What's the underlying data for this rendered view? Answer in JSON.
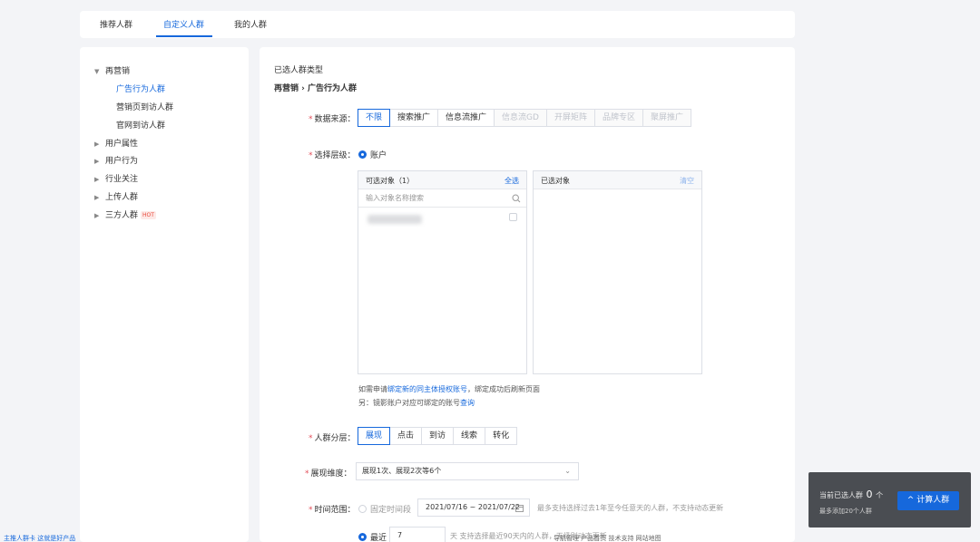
{
  "tabs": [
    "推荐人群",
    "自定义人群",
    "我的人群"
  ],
  "sidebar": {
    "items": [
      {
        "label": "再营销",
        "expanded": true,
        "children": [
          "广告行为人群",
          "营销页到访人群",
          "官网到访人群"
        ]
      },
      {
        "label": "用户属性"
      },
      {
        "label": "用户行为"
      },
      {
        "label": "行业关注"
      },
      {
        "label": "上传人群"
      },
      {
        "label": "三方人群",
        "badge": "HOT"
      }
    ]
  },
  "main": {
    "selected_type_label": "已选人群类型",
    "breadcrumb": "再营销 › 广告行为人群",
    "data_source": {
      "label": "数据来源：",
      "options": [
        "不限",
        "搜索推广",
        "信息流推广",
        "信息流GD",
        "开屏矩阵",
        "品牌专区",
        "聚屏推广"
      ]
    },
    "level": {
      "label": "选择层级：",
      "value": "账户"
    },
    "available": {
      "title": "可选对象（1）",
      "action": "全选",
      "search_placeholder": "输入对象名称搜索"
    },
    "chosen": {
      "title": "已选对象",
      "action": "清空"
    },
    "note1_pre": "如需申请",
    "note1_link": "绑定新的同主体授权账号",
    "note1_post": "，绑定成功后刷新页面",
    "note2_pre": "另：镜影账户对应可绑定的账号",
    "note2_link": "查询",
    "segmentation": {
      "label": "人群分层：",
      "options": [
        "展现",
        "点击",
        "到访",
        "线索",
        "转化"
      ]
    },
    "dimension": {
      "label": "展现维度：",
      "value": "展现1次、展现2次等6个"
    },
    "time_range": {
      "label": "时间范围：",
      "fixed_label": "固定时间段",
      "date_range": "2021/07/16 ~ 2021/07/22",
      "hint": "最多支持选择过去1年至今任意天的人群，不支持动态更新",
      "recent_label": "最近",
      "recent_value": "7",
      "recent_hint": "天  支持选择最近90天内的人群，天级别动态更新"
    }
  },
  "floater": {
    "prefix": "当前已选人群",
    "count": "0",
    "suffix": "个",
    "sub": "最多添加20个人群",
    "button": "计算人群"
  },
  "footer": {
    "left": "主推人群卡   这就是好产品",
    "right": "导航管理   产品首页   技术支持   网站地图"
  },
  "colors": {
    "accent": "#1668dc",
    "required": "#e34d59",
    "hot_text": "#e8493b"
  }
}
